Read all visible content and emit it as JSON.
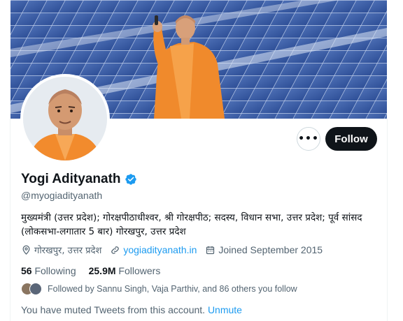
{
  "profile": {
    "display_name": "Yogi Adityanath",
    "handle": "@myogiadityanath",
    "bio": "मुख्यमंत्री (उत्तर प्रदेश); गोरक्षपीठाधीश्वर, श्री गोरक्षपीठ; सदस्य, विधान सभा, उत्तर प्रदेश; पूर्व सांसद (लोकसभा-लगातार 5 बार) गोरखपुर, उत्तर प्रदेश",
    "location": "गोरखपुर, उत्तर प्रदेश",
    "website": "yogiadityanath.in",
    "joined": "Joined September 2015",
    "verified_color": "#1d9bf0"
  },
  "actions": {
    "more_label": "•••",
    "follow_label": "Follow"
  },
  "stats": {
    "following_count": "56",
    "following_label": "Following",
    "followers_count": "25.9M",
    "followers_label": "Followers"
  },
  "followed_by": {
    "text": "Followed by Sannu Singh, Vaja Parthiv, and 86 others you follow"
  },
  "muted": {
    "text": "You have muted Tweets from this account.",
    "action_label": "Unmute"
  },
  "colors": {
    "text_primary": "#0f1419",
    "text_secondary": "#536471",
    "link": "#1d9bf0",
    "follow_button_bg": "#0f1419",
    "banner_sky": "#6f8fc6",
    "robe": "#f08a2c"
  },
  "icons": {
    "location": "location-pin-icon",
    "link": "link-icon",
    "calendar": "calendar-icon",
    "verified": "verified-badge-icon"
  }
}
